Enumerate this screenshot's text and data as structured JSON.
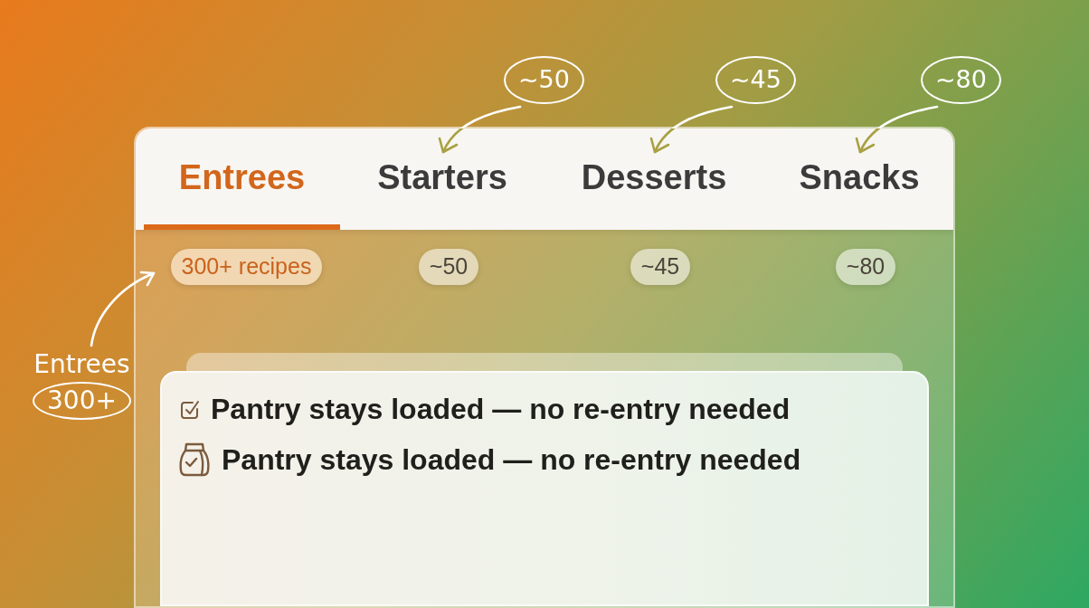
{
  "tabs": [
    {
      "label": "Entrees",
      "selected": true,
      "count": "300+ recipes"
    },
    {
      "label": "Starters",
      "selected": false,
      "count": "~50",
      "annotation": "~50"
    },
    {
      "label": "Desserts",
      "selected": false,
      "count": "~45",
      "annotation": "~45"
    },
    {
      "label": "Snacks",
      "selected": false,
      "count": "~80",
      "annotation": "~80"
    }
  ],
  "side_note": {
    "label": "Entrees",
    "count": "300+"
  },
  "card": {
    "items": [
      {
        "kind": "checkbox",
        "text": "Pantry stays loaded — no re-entry needed"
      },
      {
        "kind": "bag",
        "text": "Pantry stays loaded — no re-entry needed"
      }
    ]
  }
}
